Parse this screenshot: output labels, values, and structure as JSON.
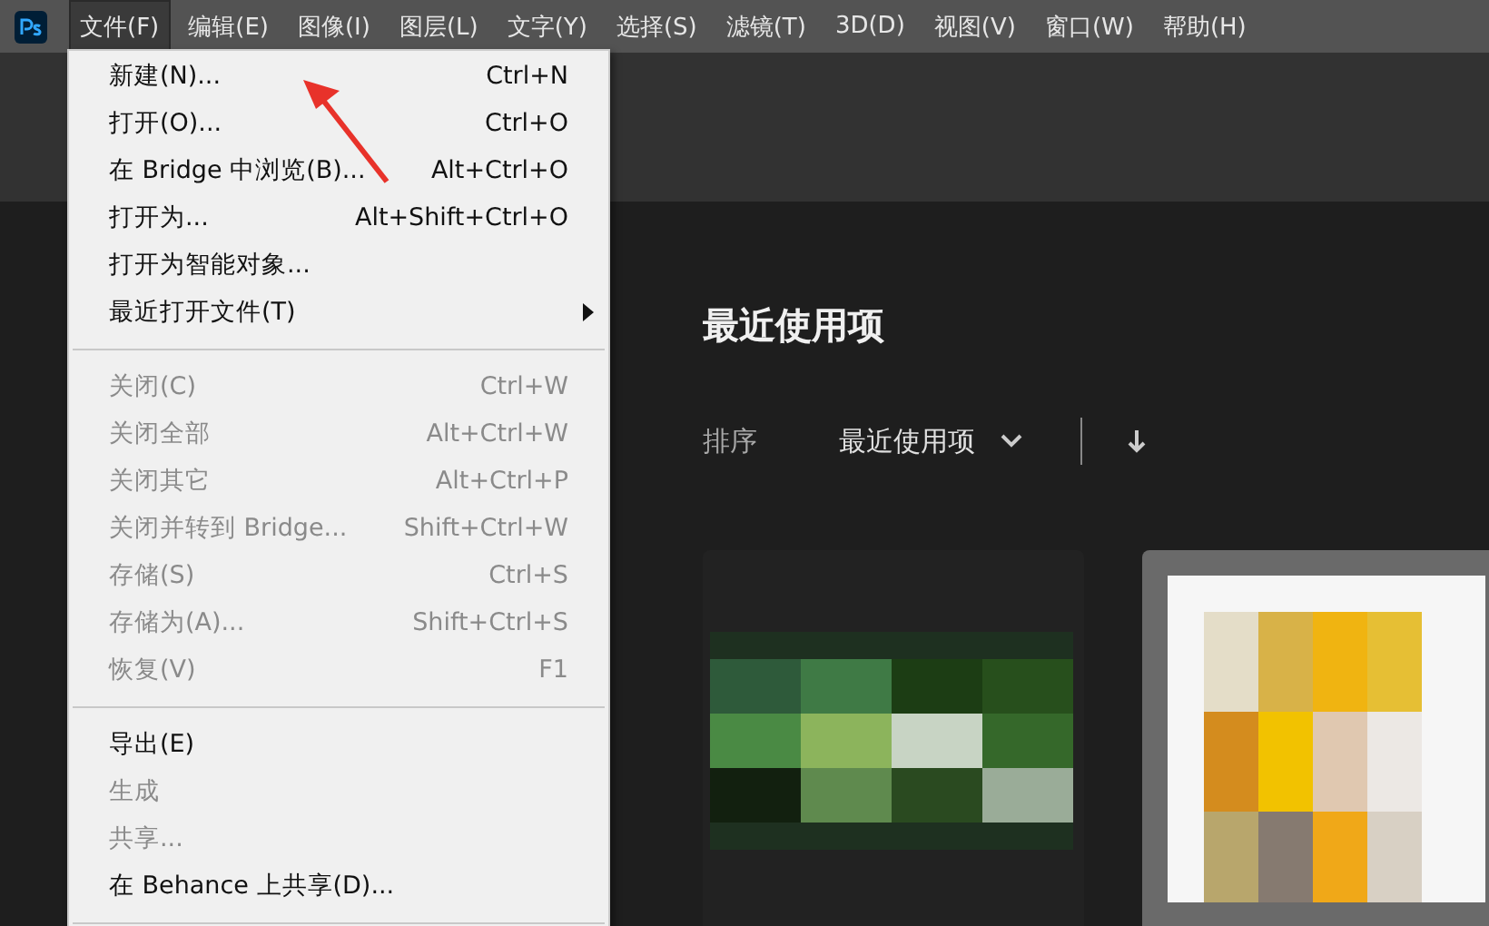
{
  "menubar": {
    "items": [
      {
        "label": "文件(F)",
        "selected": true
      },
      {
        "label": "编辑(E)",
        "selected": false
      },
      {
        "label": "图像(I)",
        "selected": false
      },
      {
        "label": "图层(L)",
        "selected": false
      },
      {
        "label": "文字(Y)",
        "selected": false
      },
      {
        "label": "选择(S)",
        "selected": false
      },
      {
        "label": "滤镜(T)",
        "selected": false
      },
      {
        "label": "3D(D)",
        "selected": false
      },
      {
        "label": "视图(V)",
        "selected": false
      },
      {
        "label": "窗口(W)",
        "selected": false
      },
      {
        "label": "帮助(H)",
        "selected": false
      }
    ]
  },
  "file_menu": {
    "items": [
      {
        "kind": "item",
        "label": "新建(N)...",
        "shortcut": "Ctrl+N",
        "disabled": false
      },
      {
        "kind": "item",
        "label": "打开(O)...",
        "shortcut": "Ctrl+O",
        "disabled": false
      },
      {
        "kind": "item",
        "label": "在 Bridge 中浏览(B)...",
        "shortcut": "Alt+Ctrl+O",
        "disabled": false
      },
      {
        "kind": "item",
        "label": "打开为...",
        "shortcut": "Alt+Shift+Ctrl+O",
        "disabled": false
      },
      {
        "kind": "item",
        "label": "打开为智能对象...",
        "disabled": false
      },
      {
        "kind": "submenu",
        "label": "最近打开文件(T)",
        "disabled": false
      },
      {
        "kind": "separator"
      },
      {
        "kind": "item",
        "label": "关闭(C)",
        "shortcut": "Ctrl+W",
        "disabled": true
      },
      {
        "kind": "item",
        "label": "关闭全部",
        "shortcut": "Alt+Ctrl+W",
        "disabled": true
      },
      {
        "kind": "item",
        "label": "关闭其它",
        "shortcut": "Alt+Ctrl+P",
        "disabled": true
      },
      {
        "kind": "item",
        "label": "关闭并转到 Bridge...",
        "shortcut": "Shift+Ctrl+W",
        "disabled": true
      },
      {
        "kind": "item",
        "label": "存储(S)",
        "shortcut": "Ctrl+S",
        "disabled": true
      },
      {
        "kind": "item",
        "label": "存储为(A)...",
        "shortcut": "Shift+Ctrl+S",
        "disabled": true
      },
      {
        "kind": "item",
        "label": "恢复(V)",
        "shortcut": "F1",
        "disabled": true
      },
      {
        "kind": "separator"
      },
      {
        "kind": "item",
        "label": "导出(E)",
        "disabled": false
      },
      {
        "kind": "item",
        "label": "生成",
        "disabled": true
      },
      {
        "kind": "item",
        "label": "共享...",
        "disabled": true
      },
      {
        "kind": "item",
        "label": "在 Behance 上共享(D)...",
        "disabled": false
      },
      {
        "kind": "separator"
      }
    ]
  },
  "home": {
    "title": "最近使用项",
    "sort_label": "排序",
    "sort_value": "最近使用项"
  }
}
